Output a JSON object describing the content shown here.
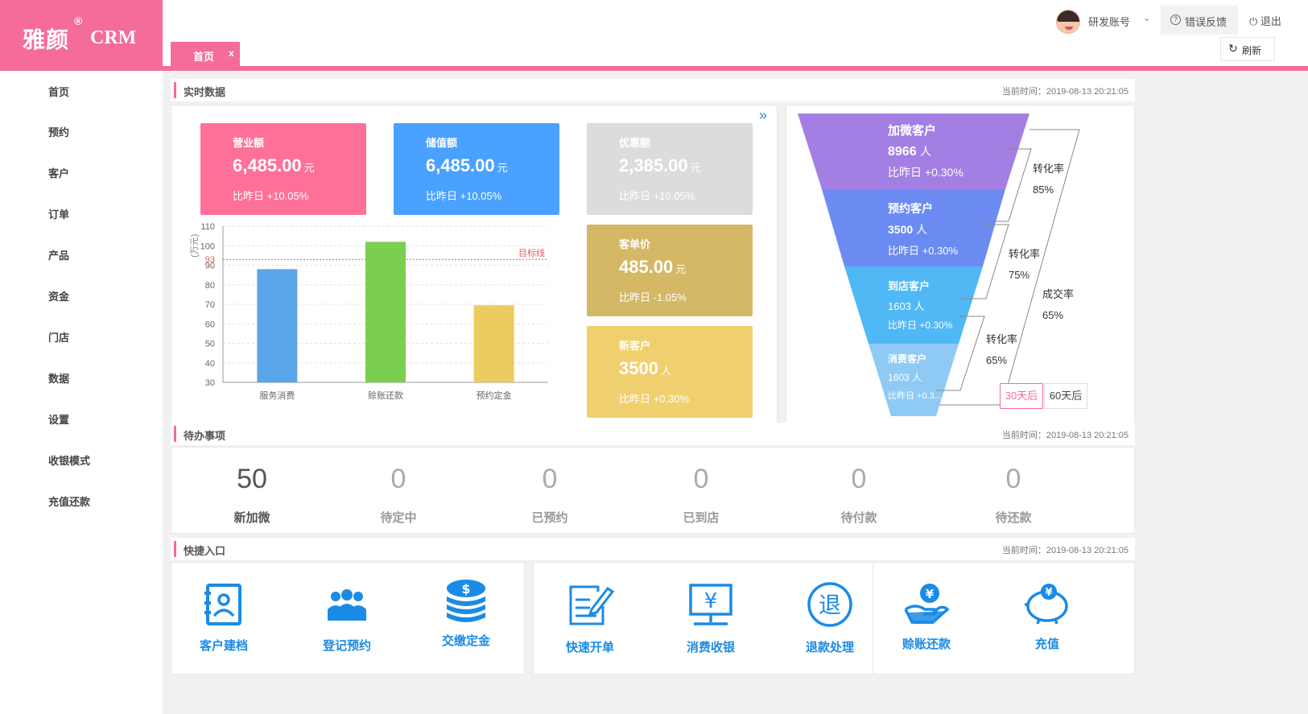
{
  "brand": {
    "name_cn": "雅颜",
    "reg": "®",
    "name_en": "CRM",
    "color": "#f56b9a"
  },
  "tab": {
    "label": "首页",
    "close": "x"
  },
  "header": {
    "account": "研发账号",
    "account_caret": "⌄",
    "feedback": "错误反馈",
    "logout": "退出",
    "refresh": "刷新"
  },
  "sidebar": {
    "items": [
      {
        "label": "首页"
      },
      {
        "label": "预约"
      },
      {
        "label": "客户"
      },
      {
        "label": "订单"
      },
      {
        "label": "产品"
      },
      {
        "label": "资金"
      },
      {
        "label": "门店"
      },
      {
        "label": "数据"
      },
      {
        "label": "设置"
      },
      {
        "label": "收银模式"
      },
      {
        "label": "充值还款"
      }
    ]
  },
  "realtime": {
    "title": "实时数据",
    "time": "当前时间：2019-08-13 20:21:05",
    "more": "»",
    "cards": [
      {
        "title": "营业额",
        "value": "6,485.00",
        "unit": "元",
        "compare": "比昨日 +10.05%",
        "color": "#ff7098"
      },
      {
        "title": "储值额",
        "value": "6,485.00",
        "unit": "元",
        "compare": "比昨日 +10.05%",
        "color": "#4aa1ff"
      },
      {
        "title": "优惠额",
        "value": "2,385.00",
        "unit": "元",
        "compare": "比昨日 +10.05%",
        "color": "#dcdcdc"
      },
      {
        "title": "客单价",
        "value": "485.00",
        "unit": "元",
        "compare": "比昨日 -1.05%",
        "color": "#d4b865"
      },
      {
        "title": "新客户",
        "value": "3500",
        "unit": "人",
        "compare": "比昨日 +0.30%",
        "color": "#f0d06e"
      }
    ]
  },
  "chart_data": {
    "type": "bar",
    "categories": [
      "服务消费",
      "赊账还款",
      "预约定金"
    ],
    "values": [
      88,
      102,
      69.5
    ],
    "colors": [
      "#5ba5ea",
      "#7bcf4e",
      "#eccb5f"
    ],
    "ylabel": "(万元)",
    "ylim": [
      30,
      110
    ],
    "yticks": [
      30,
      40,
      50,
      60,
      70,
      80,
      90,
      100,
      110
    ],
    "target": {
      "value": 93,
      "label": "目标线",
      "tick_label": "93"
    },
    "grid": true
  },
  "funnel": {
    "stages": [
      {
        "name": "加微客户",
        "count": "8966",
        "unit": "人",
        "compare": "比昨日 +0.30%",
        "color": "#a37fe4"
      },
      {
        "name": "预约客户",
        "count": "3500",
        "unit": "人",
        "compare": "比昨日 +0.30%",
        "color": "#6c8bf2"
      },
      {
        "name": "到店客户",
        "count": "1603",
        "unit": "人",
        "compare": "比昨日 +0.30%",
        "color": "#4fb8f5"
      },
      {
        "name": "消费客户",
        "count": "1603",
        "unit": "人",
        "compare": "比昨日 +0.3...",
        "color": "#8fcaf5"
      }
    ],
    "rates": [
      {
        "label": "转化率",
        "value": "85%"
      },
      {
        "label": "转化率",
        "value": "75%"
      },
      {
        "label": "转化率",
        "value": "65%"
      }
    ],
    "total_rate": {
      "label": "成交率",
      "value": "65%"
    },
    "range_buttons": [
      "30天后",
      "60天后"
    ],
    "selected_range": "30天后"
  },
  "todo": {
    "title": "待办事项",
    "time": "当前时间：2019-08-13 20:21:05",
    "items": [
      {
        "value": "50",
        "label": "新加微"
      },
      {
        "value": "0",
        "label": "待定中"
      },
      {
        "value": "0",
        "label": "已预约"
      },
      {
        "value": "0",
        "label": "已到店"
      },
      {
        "value": "0",
        "label": "待付款"
      },
      {
        "value": "0",
        "label": "待还款"
      }
    ]
  },
  "quick": {
    "title": "快捷入口",
    "time": "当前时间：2019-08-13 20:21:05",
    "items": [
      {
        "label": "客户建档",
        "icon": "customer-file-icon"
      },
      {
        "label": "登记预约",
        "icon": "group-users-icon"
      },
      {
        "label": "交缴定金",
        "icon": "coin-stack-icon"
      },
      {
        "label": "快速开单",
        "icon": "edit-document-icon"
      },
      {
        "label": "消费收银",
        "icon": "cashier-monitor-icon"
      },
      {
        "label": "退款处理",
        "icon": "refund-icon"
      },
      {
        "label": "赊账还款",
        "icon": "credit-repay-icon"
      },
      {
        "label": "充值",
        "icon": "piggy-bank-icon"
      }
    ]
  }
}
